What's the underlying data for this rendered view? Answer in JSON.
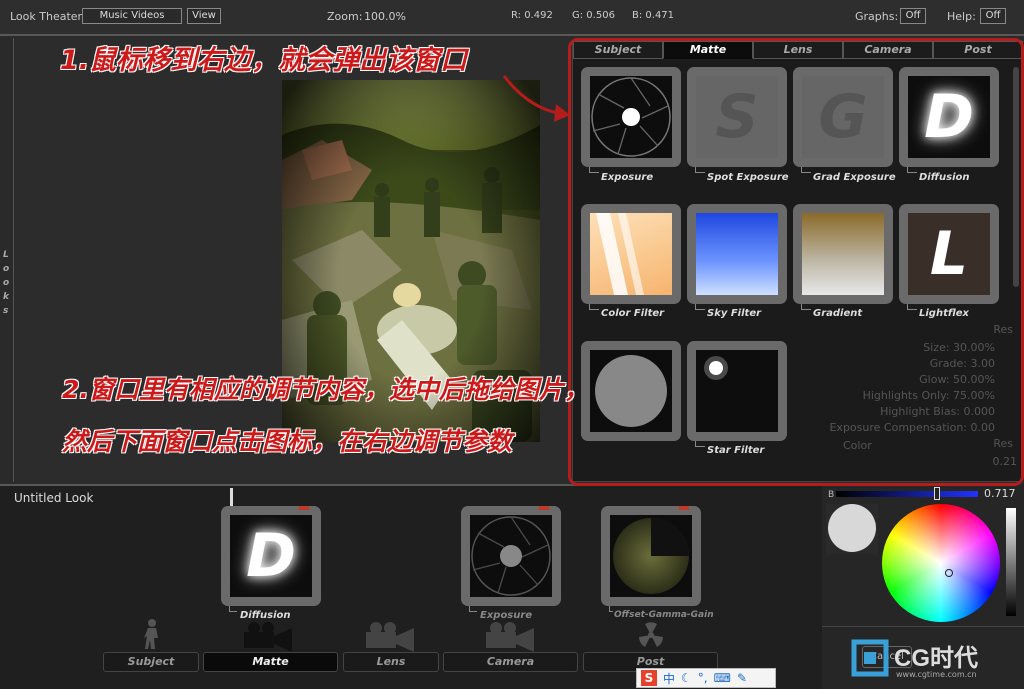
{
  "topbar": {
    "look_theater_label": "Look Theater:",
    "look_theater_value": "Music Videos",
    "view_button": "View",
    "zoom_label": "Zoom:",
    "zoom_value": "100.0%",
    "r_readout": "R: 0.492",
    "g_readout": "G: 0.506",
    "b_readout": "B: 0.471",
    "graphs_label": "Graphs:",
    "graphs_value": "Off",
    "help_label": "Help:",
    "help_value": "Off"
  },
  "left_rail": {
    "letters": [
      "L",
      "o",
      "o",
      "k",
      "s"
    ]
  },
  "panel": {
    "tabs": [
      "Subject",
      "Matte",
      "Lens",
      "Camera",
      "Post"
    ],
    "active_tab": "Matte",
    "tools": [
      {
        "label": "Exposure",
        "icon": "aperture-icon"
      },
      {
        "label": "Spot Exposure",
        "icon": "letter-s-icon",
        "letter": "S"
      },
      {
        "label": "Grad Exposure",
        "icon": "letter-g-icon",
        "letter": "G"
      },
      {
        "label": "Diffusion",
        "icon": "letter-d-icon",
        "letter": "D"
      },
      {
        "label": "Color Filter",
        "icon": "color-filter-icon"
      },
      {
        "label": "Sky Filter",
        "icon": "sky-filter-icon"
      },
      {
        "label": "Gradient",
        "icon": "gradient-icon"
      },
      {
        "label": "Lightflex",
        "icon": "letter-l-icon",
        "letter": "L"
      },
      {
        "label": "Star Filter",
        "icon": "star-filter-icon"
      }
    ],
    "faded_params": [
      "Size: 30.00%",
      "Grade: 3.00",
      "Glow: 50.00%",
      "Highlights Only: 75.00%",
      "Highlight Bias: 0.000",
      "Exposure Compensation: 0.00"
    ],
    "faded_color_label": "Color",
    "faded_reset": "Res",
    "faded_value": "0.21"
  },
  "bottom": {
    "look_name": "Untitled Look",
    "stack": [
      {
        "label": "Diffusion",
        "letter": "D"
      },
      {
        "label": "Exposure"
      },
      {
        "label": "Offset-Gamma-Gain"
      }
    ],
    "tabs": [
      "Subject",
      "Matte",
      "Lens",
      "Camera",
      "Post"
    ],
    "active_tab": "Matte"
  },
  "color_panel": {
    "channel_label": "B",
    "channel_value": "0.717",
    "cancel_label": "Cancel"
  },
  "annotations": {
    "step1": "1.鼠标移到右边，就会弹出该窗口",
    "step2_line1": "2.窗口里有相应的调节内容，选中后拖给图片，",
    "step2_line2": "然后下面窗口点击图标，在右边调节参数"
  },
  "watermark": {
    "brand": "CG时代",
    "url": "www.cgtime.com.cn"
  },
  "ime_bar": {
    "glyphs": [
      "中",
      "°,"
    ]
  },
  "colors": {
    "annotation_red": "#cc1a1a",
    "frame_red": "#b51c1c",
    "sky_blue": "#1f47e0",
    "gradient_brown": "#8a6a2a"
  }
}
